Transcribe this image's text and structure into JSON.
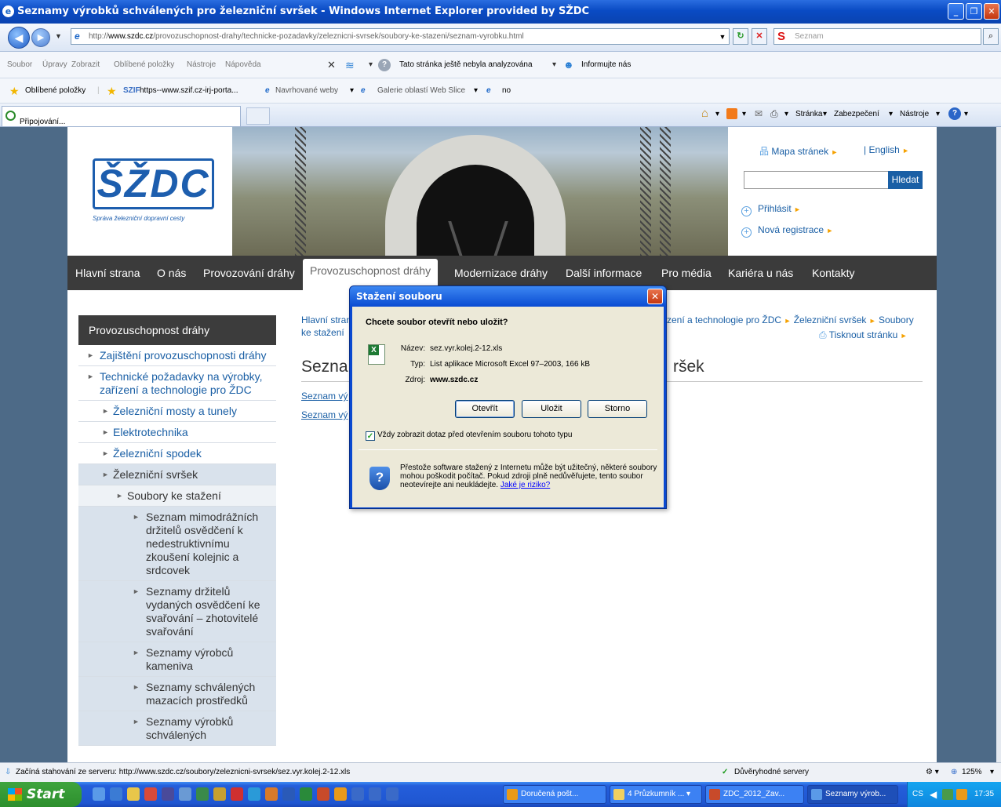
{
  "window": {
    "title": "Seznamy výrobků schválených pro železniční svršek - Windows Internet Explorer provided by SŽDC"
  },
  "address": {
    "url_prefix": "http://",
    "url_host": "www.szdc.cz",
    "url_path": "/provozuschopnost-drahy/technicke-pozadavky/zeleznicni-svrsek/soubory-ke-stazeni/seznam-vyrobku.html"
  },
  "search": {
    "engine": "S",
    "placeholder": "Seznam"
  },
  "menu": {
    "items": [
      "Soubor",
      "Úpravy",
      "Zobrazit",
      "Oblíbené položky",
      "Nástroje",
      "Nápověda"
    ],
    "analyze": "Tato stránka ještě nebyla analyzována",
    "inform": "Informujte nás"
  },
  "favorites": {
    "label": "Oblíbené položky",
    "links": [
      "https--www.szif.cz-irj-porta...",
      "Navrhované weby",
      "Galerie oblastí Web Slice",
      "no"
    ]
  },
  "tab": {
    "label": "Připojování..."
  },
  "commands": [
    "Stránka",
    "Zabezpečení",
    "Nástroje"
  ],
  "site": {
    "logo_text": "ŠŽDC",
    "logo_subtitle": "Správa železniční dopravní cesty",
    "sitemap": "Mapa stránek",
    "english": "| English",
    "search_button": "Hledat",
    "login": "Přihlásit",
    "register": "Nová registrace",
    "nav": [
      "Hlavní strana",
      "O nás",
      "Provozování dráhy",
      "Provozuschopnost dráhy",
      "Modernizace dráhy",
      "Další informace",
      "Pro média",
      "Kariéra u nás",
      "Kontakty"
    ],
    "left_menu": {
      "header": "Provozuschopnost dráhy",
      "items": [
        "Zajištění provozuschopnosti dráhy",
        "Technické požadavky na výrobky, zařízení a technologie pro ŽDC",
        "Železniční mosty a tunely",
        "Elektrotechnika",
        "Železniční spodek",
        "Železniční svršek",
        "Soubory ke stažení",
        "Seznam mimodrážních držitelů osvědčení k nedestruktivnímu zkoušení kolejnic a srdcovek",
        "Seznamy držitelů vydaných osvědčení ke svařování – zhotovitelé svařování",
        "Seznamy výrobců kameniva",
        "Seznamy schválených mazacích prostředků",
        "Seznamy výrobků schválených"
      ]
    },
    "breadcrumb_start": "Hlavní stran",
    "breadcrumb_cont": "ke stažení",
    "breadcrumb_end": "zení a technologie pro ŽDC",
    "breadcrumb_svrsek": "Železniční svršek",
    "breadcrumb_soubory": "Soubory",
    "print": "Tisknout stránku",
    "title_left": "Sezna",
    "title_right": "ršek",
    "links": [
      "Seznam vý",
      "Seznam vý"
    ]
  },
  "dialog": {
    "title": "Stažení souboru",
    "question": "Chcete soubor otevřít nebo uložit?",
    "name_label": "Název:",
    "name_value": "sez.vyr.kolej.2-12.xls",
    "type_label": "Typ:",
    "type_value": "List aplikace Microsoft Excel 97–2003, 166 kB",
    "source_label": "Zdroj:",
    "source_value": "www.szdc.cz",
    "open": "Otevřít",
    "save": "Uložit",
    "cancel": "Storno",
    "checkbox": "Vždy zobrazit dotaz před otevřením souboru tohoto typu",
    "warning": "Přestože software stažený z Internetu může být užitečný, některé soubory mohou poškodit počítač. Pokud zdroji plně nedůvěřujete, tento soubor neotevírejte ani neukládejte.",
    "risk_link": "Jaké je riziko?"
  },
  "status": {
    "text": "Začíná stahování ze serveru: http://www.szdc.cz/soubory/zeleznicni-svrsek/sez.vyr.kolej.2-12.xls",
    "zone": "Důvěryhodné servery",
    "zoom": "125%"
  },
  "taskbar": {
    "start": "Start",
    "tasks": [
      "Doručená pošt...",
      "4 Průzkumník ...",
      "ZDC_2012_Zav...",
      "Seznamy výrob..."
    ],
    "lang": "CS",
    "time": "17:35"
  },
  "colors": {
    "link": "#1a5fa5",
    "accent_arrow": "#f5a100",
    "nav_bg": "#3b3b3b",
    "dialog_blue": "#0a49d0"
  }
}
